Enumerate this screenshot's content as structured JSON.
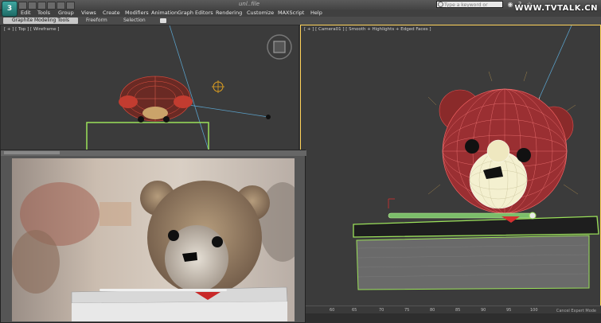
{
  "app": {
    "logo_icon": "3ds-max-logo",
    "document_title": "unl..file",
    "search_placeholder": "Type a keyword or phrase",
    "watermark": "WWW.TVTALK.CN"
  },
  "menu": [
    "Edit",
    "Tools",
    "Group",
    "Views",
    "Create",
    "Modifiers",
    "Animation",
    "Graph Editors",
    "Rendering",
    "Customize",
    "MAXScript",
    "Help"
  ],
  "ribbon": {
    "active_tab": "Graphite Modeling Tools",
    "tabs": [
      "Freeform",
      "Selection"
    ]
  },
  "viewports": {
    "top_label": "[ + ] [ Top ] [ Wireframe ]",
    "camera_label": "[ + ] [ Camera01 ] [ Smooth + Highlights + Edged Faces ]"
  },
  "timeline": {
    "ticks": [
      "60",
      "65",
      "70",
      "75",
      "80",
      "85",
      "90",
      "95",
      "100"
    ],
    "expert_mode": "Cancel Expert Mode"
  },
  "colors": {
    "selection_green": "#9be15a",
    "wire_red": "#c8463c",
    "active_viewport": "#ffd35a"
  }
}
